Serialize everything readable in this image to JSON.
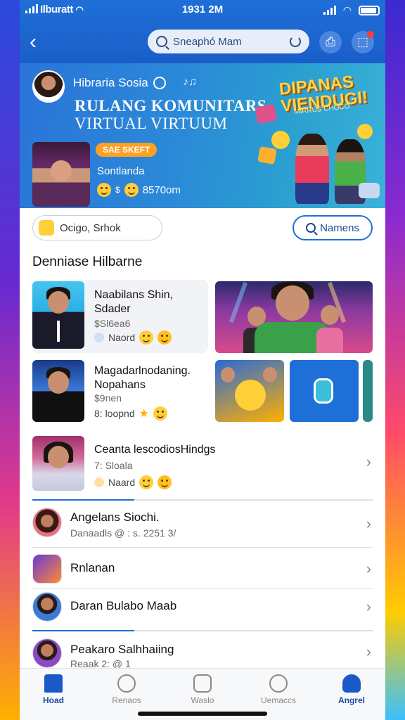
{
  "status_bar": {
    "carrier": "Ilburatt",
    "time": "1931 2M"
  },
  "header": {
    "search_placeholder": "Sneaphó Mam"
  },
  "banner": {
    "user_name": "Hibraria Sosia",
    "title_line1": "RULANG KOMUNITARS",
    "title_line2": "VIRTUAL VIRTUUM",
    "host_tag": "SAE SKEFT",
    "host_name": "Sontlanda",
    "host_stats": "8570om",
    "art_headline": "DIPANAS VIENDUGI!",
    "art_sub": "MIRRUS CHOCO"
  },
  "filters": {
    "chip_label": "Ocigo, Srhok",
    "names_button": "Namens"
  },
  "section": {
    "title": "Denniase Hilbarne"
  },
  "cards": [
    {
      "title": "Naabilans Shin, Sdader",
      "price": "$Sl6ea6",
      "meta": "Naord"
    },
    {
      "title": "Magadarlnodaning. Nopahans",
      "price": "$9nen",
      "meta": "8: loopnd"
    },
    {
      "title": "Ceanta lescodiosHindgs",
      "price": "7: Sloala",
      "meta": "Naard"
    }
  ],
  "list": [
    {
      "title": "Angelans Siochi.",
      "sub": "Danaadls @ : s. 2251 3/"
    },
    {
      "title": "Rnlanan",
      "sub": ""
    },
    {
      "title": "Daran Bulabo Maab",
      "sub": ""
    },
    {
      "title": "Peakaro Salhhaiing",
      "sub": "Reaak 2: @ 1"
    }
  ],
  "tabs": [
    {
      "label": "Hoad",
      "icon": "home-icon"
    },
    {
      "label": "Renaos",
      "icon": "puzzle-icon"
    },
    {
      "label": "Waslo",
      "icon": "game-icon"
    },
    {
      "label": "Uemaccs",
      "icon": "messages-icon"
    },
    {
      "label": "Angrel",
      "icon": "profile-icon"
    }
  ],
  "colors": {
    "primary": "#1f6fd8",
    "accent": "#ffa020",
    "active_tab": "#1a4aa0"
  }
}
